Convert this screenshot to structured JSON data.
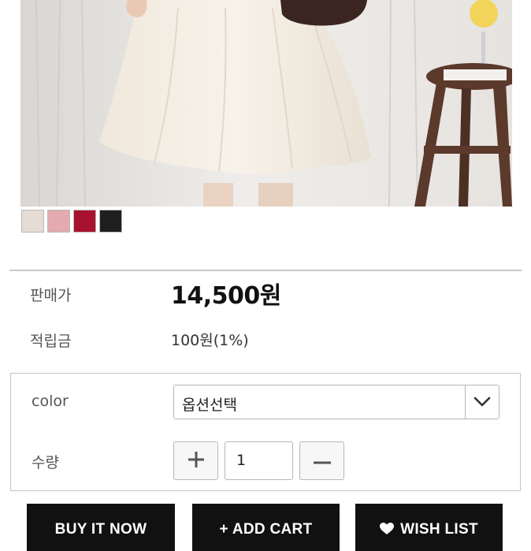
{
  "swatches": [
    {
      "name": "ivory",
      "color": "#e7dcd4"
    },
    {
      "name": "pink",
      "color": "#e3aab0"
    },
    {
      "name": "wine",
      "color": "#a8122e"
    },
    {
      "name": "black",
      "color": "#1f1f1f"
    }
  ],
  "price_row": {
    "label": "판매가",
    "value": "14,500원"
  },
  "points_row": {
    "label": "적립금",
    "value": "100원(1%)"
  },
  "options": {
    "color_label": "color",
    "color_select_value": "옵션선택",
    "quantity_label": "수량",
    "quantity_value": "1"
  },
  "actions": {
    "buy_now": "BUY IT NOW",
    "add_cart": "+ ADD CART",
    "wish_list": "WISH LIST"
  },
  "icons": {
    "select_arrow": "chevron-down-icon",
    "plus": "plus-icon",
    "minus": "minus-icon",
    "wish": "heart-icon"
  }
}
